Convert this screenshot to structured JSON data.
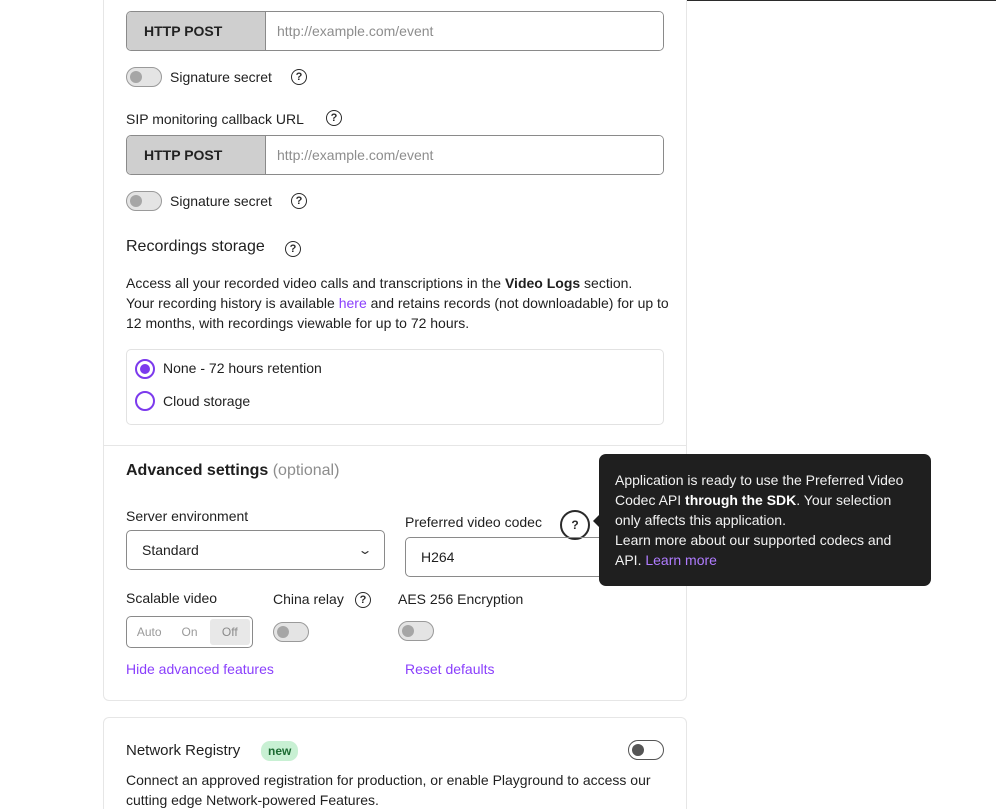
{
  "webhook_top": {
    "method_label": "HTTP POST",
    "url_placeholder": "http://example.com/event",
    "signature_label": "Signature secret"
  },
  "sip_monitoring": {
    "label": "SIP monitoring callback URL",
    "method_label": "HTTP POST",
    "url_placeholder": "http://example.com/event",
    "signature_label": "Signature secret"
  },
  "recordings": {
    "title": "Recordings storage",
    "desc_1": "Access all your recorded video calls and transcriptions in the ",
    "desc_bold": "Video Logs",
    "desc_2": " section.",
    "desc_3": "Your recording history is available ",
    "desc_link": "here",
    "desc_4": " and retains records (not downloadable) for up to 12 months, with recordings viewable for up to 72 hours.",
    "options": [
      {
        "label": "None - 72 hours retention",
        "selected": true
      },
      {
        "label": "Cloud storage",
        "selected": false
      }
    ]
  },
  "advanced": {
    "title": "Advanced settings",
    "optional": "(optional)",
    "server_env_label": "Server environment",
    "server_env_value": "Standard",
    "codec_label": "Preferred video codec",
    "codec_value": "H264",
    "scalable_label": "Scalable video",
    "scalable_options": [
      "Auto",
      "On",
      "Off"
    ],
    "scalable_selected": "Off",
    "china_relay_label": "China relay",
    "aes_label": "AES 256 Encryption",
    "hide_link": "Hide advanced features",
    "reset_link": "Reset defaults"
  },
  "tooltip": {
    "text_1": "Application is ready to use the Preferred Video Codec API ",
    "text_bold": "through the SDK",
    "text_2": ". Your selection only affects this application.",
    "text_3": "Learn more about our supported codecs and API. ",
    "link": "Learn more"
  },
  "network_registry": {
    "title": "Network Registry",
    "badge": "new",
    "desc": "Connect an approved registration for production, or enable Playground to access our cutting edge Network-powered Features."
  },
  "colors": {
    "accent": "#7c3aed",
    "link": "#8a3ffc",
    "tooltip_bg": "#1f1f1f",
    "badge_bg": "#c8f0d3"
  }
}
